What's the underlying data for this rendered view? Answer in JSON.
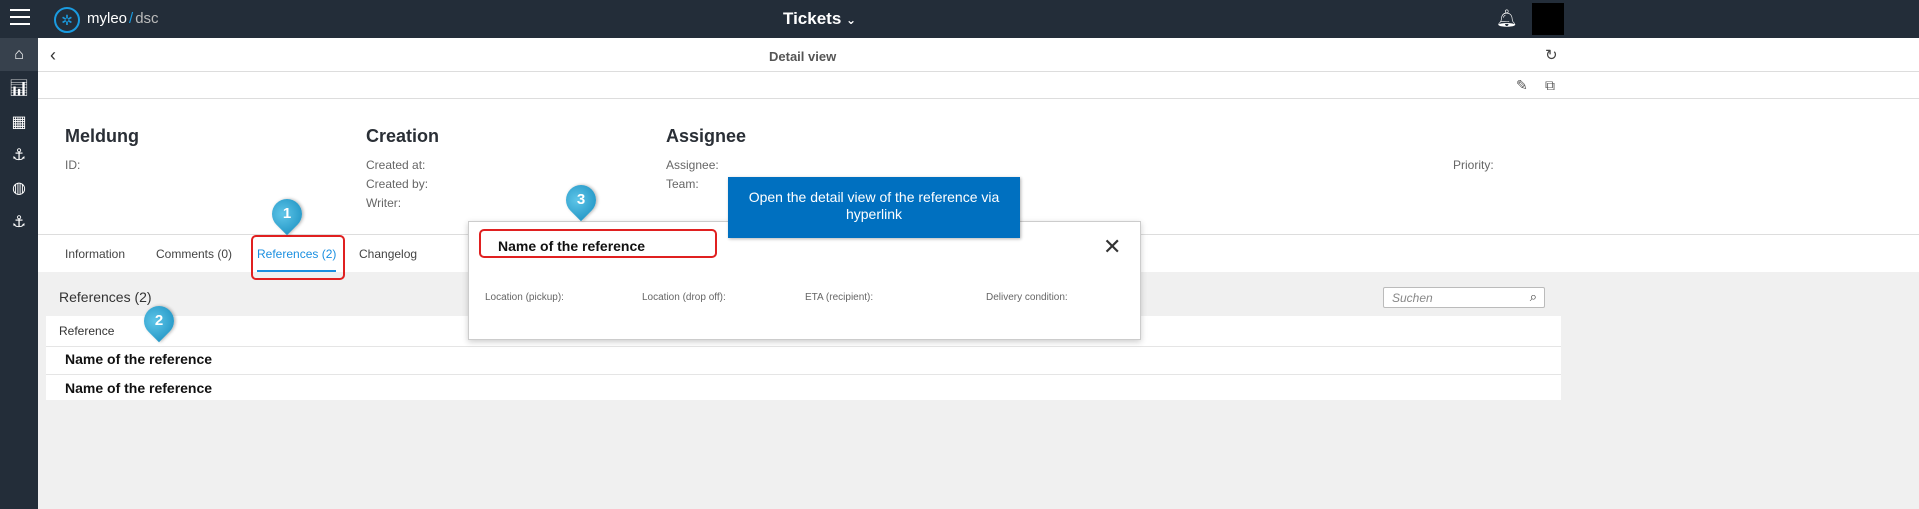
{
  "topbar": {
    "logo_main": "myleo",
    "logo_sep": "/",
    "logo_sub": "dsc",
    "title": "Tickets"
  },
  "header": {
    "title": "Detail view"
  },
  "sections": {
    "meldung": {
      "title": "Meldung",
      "fields": [
        "ID:"
      ]
    },
    "creation": {
      "title": "Creation",
      "fields": [
        "Created at:",
        "Created by:",
        "Writer:"
      ]
    },
    "assignee": {
      "title": "Assignee",
      "fields": [
        "Assignee:",
        "Team:"
      ]
    },
    "priority": "Priority:"
  },
  "tabs": [
    {
      "label": "Information"
    },
    {
      "label": "Comments (0)"
    },
    {
      "label": "References (2)",
      "active": true
    },
    {
      "label": "Changelog"
    }
  ],
  "references": {
    "title": "References (2)",
    "search_placeholder": "Suchen",
    "column": "Reference",
    "rows": [
      "Name of the reference",
      "Name of the reference"
    ]
  },
  "popup": {
    "title": "Name of the reference",
    "fields": [
      "Location (pickup):",
      "Location (drop off):",
      "ETA (recipient):",
      "Delivery condition:"
    ]
  },
  "annotations": {
    "tooltip": "Open the detail view of the reference via hyperlink",
    "markers": [
      "1",
      "2",
      "3"
    ]
  },
  "colors": {
    "accent": "#1a8fe0",
    "dark": "#232d39",
    "tooltip": "#0070c0",
    "highlight": "#e02020"
  }
}
